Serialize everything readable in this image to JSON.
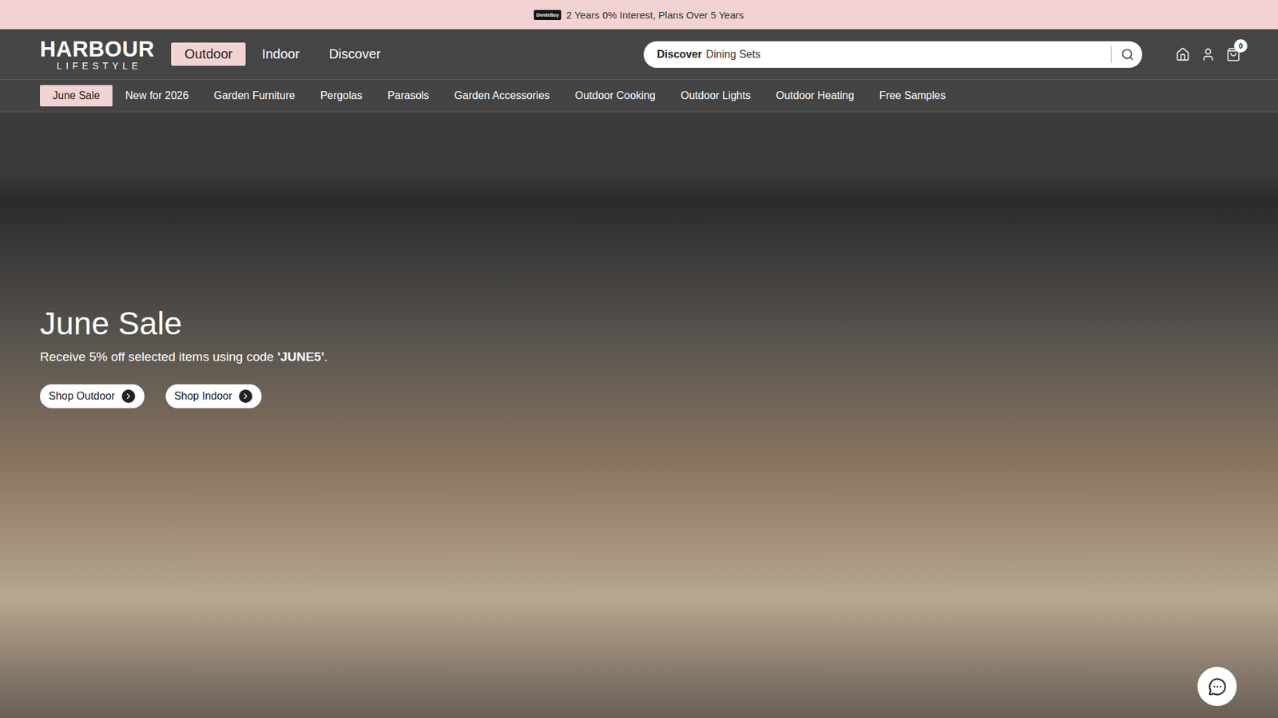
{
  "banner": {
    "logo": "DivideBuy",
    "text": "2 Years 0% Interest, Plans Over 5 Years"
  },
  "logo": {
    "name": "HARBOUR",
    "tagline": "LIFESTYLE"
  },
  "main_nav": [
    {
      "label": "Outdoor",
      "selected": true
    },
    {
      "label": "Indoor",
      "selected": false
    },
    {
      "label": "Discover",
      "selected": false
    }
  ],
  "search": {
    "prefix": "Discover",
    "placeholder": "Dining Sets"
  },
  "cart": {
    "count": "0"
  },
  "sub_nav": [
    {
      "label": "June Sale",
      "selected": true
    },
    {
      "label": "New for 2026",
      "selected": false
    },
    {
      "label": "Garden Furniture",
      "selected": false
    },
    {
      "label": "Pergolas",
      "selected": false
    },
    {
      "label": "Parasols",
      "selected": false
    },
    {
      "label": "Garden Accessories",
      "selected": false
    },
    {
      "label": "Outdoor Cooking",
      "selected": false
    },
    {
      "label": "Outdoor Lights",
      "selected": false
    },
    {
      "label": "Outdoor Heating",
      "selected": false
    },
    {
      "label": "Free Samples",
      "selected": false
    }
  ],
  "hero": {
    "title": "June Sale",
    "text_before": "Receive 5% off selected items using code ",
    "code": "'JUNE5'",
    "text_after": ".",
    "buttons": [
      "Shop Outdoor",
      "Shop Indoor"
    ]
  }
}
